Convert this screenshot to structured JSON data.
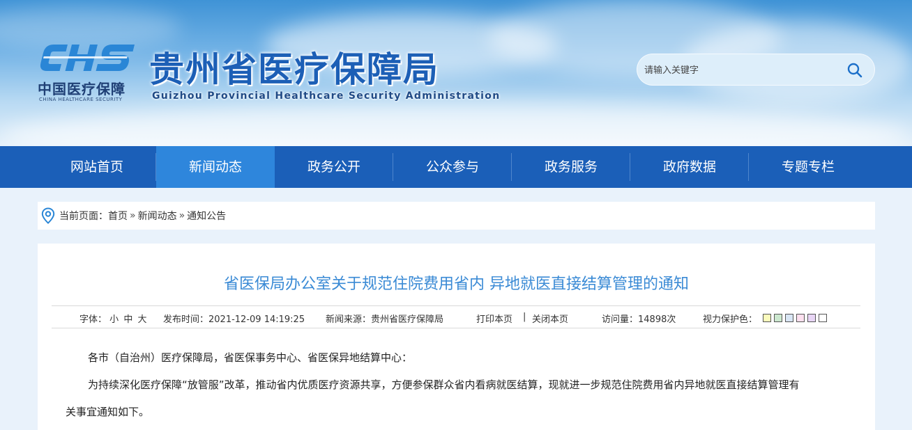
{
  "header": {
    "logo_cn": "中国医疗保障",
    "logo_en": "CHINA HEALTHCARE SECURITY",
    "title": "贵州省医疗保障局",
    "subtitle": "Guizhou Provincial Healthcare Security Administration",
    "search_placeholder": "请输入关键字"
  },
  "nav": {
    "items": [
      {
        "label": "网站首页"
      },
      {
        "label": "新闻动态"
      },
      {
        "label": "政务公开"
      },
      {
        "label": "公众参与"
      },
      {
        "label": "政务服务"
      },
      {
        "label": "政府数据"
      },
      {
        "label": "专题专栏"
      }
    ],
    "active_index": 1
  },
  "breadcrumb": {
    "prefix": "当前页面：",
    "items": [
      "首页",
      "新闻动态",
      "通知公告"
    ],
    "separator": "»"
  },
  "article": {
    "title": "省医保局办公室关于规范住院费用省内 异地就医直接结算管理的通知",
    "meta": {
      "font_label": "字体：",
      "font_small": "小",
      "font_medium": "中",
      "font_large": "大",
      "publish_label": "发布时间：",
      "publish_time": "2021-12-09 14:19:25",
      "source_label": "新闻来源：",
      "source": "贵州省医疗保障局",
      "print": "打印本页",
      "divider": "|",
      "close": "关闭本页",
      "visits_label": "访问量：",
      "visits": "14898次",
      "eye_label": "视力保护色："
    },
    "eye_colors": [
      "#fafbbc",
      "#cce8cf",
      "#d9e6f5",
      "#fde0ef",
      "#e8d5f5",
      "#ffffff"
    ],
    "paragraphs": [
      "各市（自治州）医疗保障局，省医保事务中心、省医保异地结算中心：",
      "为持续深化医疗保障“放管服”改革，推动省内优质医疗资源共享，方便参保群众省内看病就医结算，现就进一步规范住院费用省内异地就医直接结算管理有",
      "关事宜通知如下。"
    ]
  },
  "colors": {
    "nav_bg": "#1b5fb8",
    "nav_active": "#2e86dc",
    "title_blue": "#1c5fb6",
    "article_title": "#3a8ad5"
  }
}
